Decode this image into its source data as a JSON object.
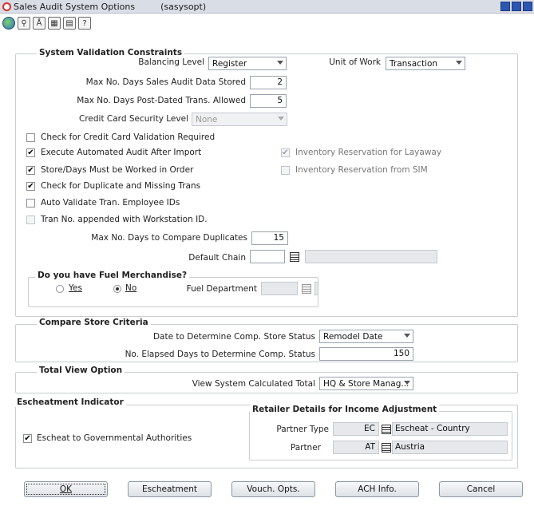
{
  "window": {
    "title": "Sales Audit System Options",
    "code": "(sasysopt)"
  },
  "toolbar": {
    "icons": [
      "globe-icon",
      "find-icon",
      "spell-icon",
      "calendar-icon",
      "notes-icon",
      "help-icon"
    ]
  },
  "svc": {
    "title": "System Validation Constraints",
    "balancing_level_label": "Balancing Level",
    "balancing_level_value": "Register",
    "unit_of_work_label": "Unit of Work",
    "unit_of_work_value": "Transaction",
    "max_days_stored_label": "Max No. Days Sales Audit Data Stored",
    "max_days_stored_value": "2",
    "max_days_postdated_label": "Max No. Days Post-Dated Trans. Allowed",
    "max_days_postdated_value": "5",
    "cc_security_label": "Credit Card Security Level",
    "cc_security_value": "None",
    "check_cc_label": "Check for Credit Card Validation Required",
    "exec_audit_label": "Execute Automated Audit After Import",
    "inv_layaway_label": "Inventory Reservation for Layaway",
    "store_days_label": "Store/Days Must be Worked in Order",
    "inv_sim_label": "Inventory Reservation from SIM",
    "check_dup_label": "Check for Duplicate and Missing Trans",
    "auto_validate_label": "Auto Validate Tran. Employee IDs",
    "tran_no_label": "Tran No. appended with Workstation ID.",
    "max_days_compare_label": "Max No. Days to Compare Duplicates",
    "max_days_compare_value": "15",
    "default_chain_label": "Default Chain",
    "default_chain_value": "",
    "fuel_title": "Do you have Fuel Merchandise?",
    "fuel_yes": "Yes",
    "fuel_no": "No",
    "fuel_dept_label": "Fuel Department"
  },
  "checks": {
    "check_cc": false,
    "exec_audit": true,
    "inv_layaway": true,
    "store_days": true,
    "inv_sim": false,
    "check_dup": true,
    "auto_validate": false,
    "tran_no": false
  },
  "csc": {
    "title": "Compare Store Criteria",
    "date_label": "Date to Determine Comp. Store Status",
    "date_value": "Remodel Date",
    "elapsed_label": "No. Elapsed Days to Determine Comp. Status",
    "elapsed_value": "150"
  },
  "tvo": {
    "title": "Total View Option",
    "view_label": "View System Calculated Total",
    "view_value": "HQ & Store Manag..."
  },
  "esch": {
    "title": "Escheatment Indicator",
    "check_label": "Escheat to Governmental Authorities",
    "retailer_title": "Retailer Details for Income Adjustment",
    "partner_type_label": "Partner Type",
    "partner_type_code": "EC",
    "partner_type_name": "Escheat - Country",
    "partner_label": "Partner",
    "partner_code": "AT",
    "partner_name": "Austria"
  },
  "buttons": {
    "ok": "OK",
    "escheatment": "Escheatment",
    "vouch": "Vouch. Opts.",
    "ach": "ACH Info.",
    "cancel": "Cancel"
  }
}
